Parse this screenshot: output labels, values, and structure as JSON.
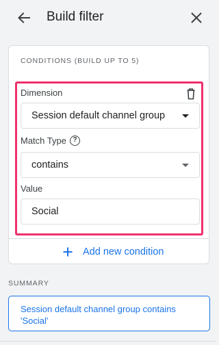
{
  "header": {
    "title": "Build filter",
    "back_icon": "arrow-back-icon",
    "close_icon": "close-icon"
  },
  "conditions": {
    "section_label": "CONDITIONS (BUILD UP TO 5)",
    "dimension_label": "Dimension",
    "dimension_value": "Session default channel group",
    "delete_icon": "trash-icon",
    "match_type_label": "Match Type",
    "help_icon": "help-circle-icon",
    "match_type_value": "contains",
    "value_label": "Value",
    "value_input": "Social",
    "add_condition_label": "Add new condition"
  },
  "summary": {
    "label": "SUMMARY",
    "text": "Session default channel group contains 'Social'"
  },
  "colors": {
    "accent": "#1a73e8",
    "highlight": "#ef2f6c",
    "background": "#f1f3f4"
  }
}
